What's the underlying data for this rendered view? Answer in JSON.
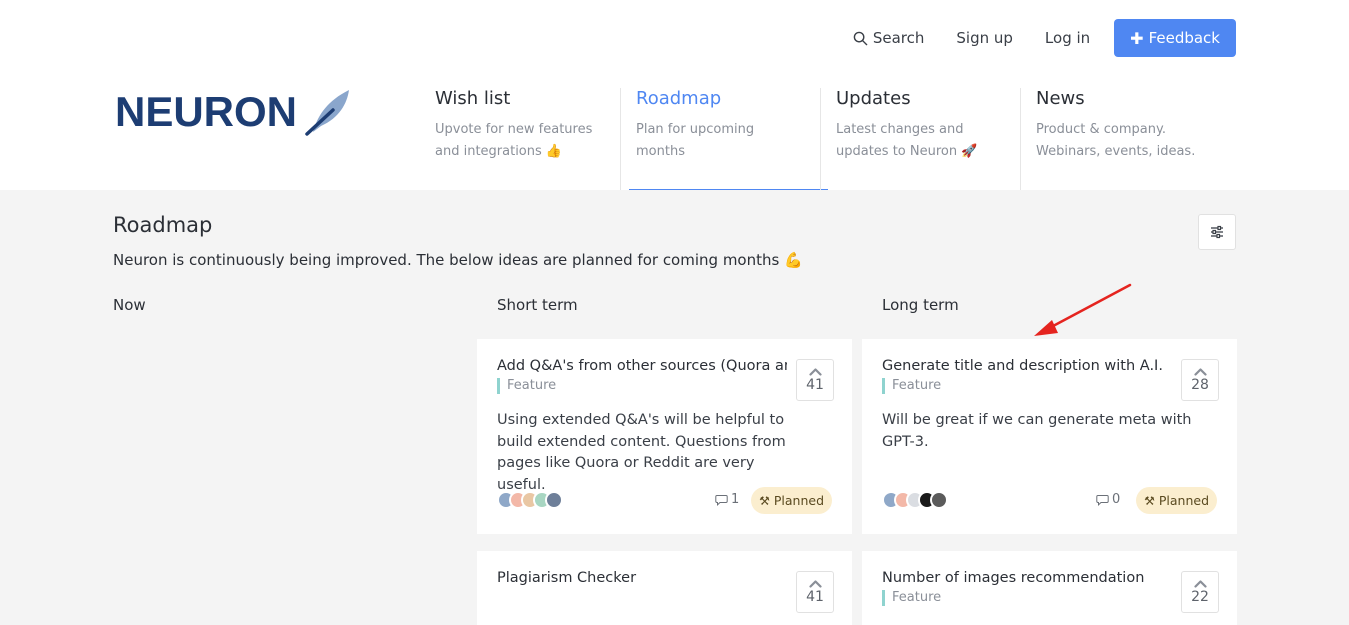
{
  "topnav": {
    "search_label": "Search",
    "signup_label": "Sign up",
    "login_label": "Log in",
    "feedback_label": "Feedback"
  },
  "logo": {
    "text": "NEURON"
  },
  "tabs": [
    {
      "title": "Wish list",
      "desc1": "Upvote for new features",
      "desc2": "and integrations 👍"
    },
    {
      "title": "Roadmap",
      "desc1": "Plan for upcoming",
      "desc2": "months"
    },
    {
      "title": "Updates",
      "desc1": "Latest changes and",
      "desc2": "updates to Neuron 🚀"
    },
    {
      "title": "News",
      "desc1": "Product & company.",
      "desc2": "Webinars, events, ideas."
    }
  ],
  "main": {
    "title": "Roadmap",
    "desc": "Neuron is continuously being improved. The below ideas are planned for coming months 💪"
  },
  "columns": [
    "Now",
    "Short term",
    "Long term"
  ],
  "cards": [
    {
      "title": "Add Q&A's from other sources (Quora and Reddit)",
      "tag": "Feature",
      "body": "Using extended Q&A's will be helpful to build extended content. Questions from pages like Quora or Reddit are very useful.",
      "votes": "41",
      "comments": "1",
      "status": "Planned"
    },
    {
      "title": "Generate title and description with A.I.",
      "tag": "Feature",
      "body": "Will be great if we can generate meta with GPT-3.",
      "votes": "28",
      "comments": "0",
      "status": "Planned"
    },
    {
      "title": "Plagiarism Checker",
      "votes": "41"
    },
    {
      "title": "Number of images recommendation",
      "tag": "Feature",
      "votes": "22"
    }
  ],
  "colors": {
    "accent": "#4f87f2",
    "logo": "#1d3d73",
    "status_bg": "#fbeecf",
    "tag_bar": "#8fd3cf",
    "annotation_arrow": "#e5241f"
  }
}
